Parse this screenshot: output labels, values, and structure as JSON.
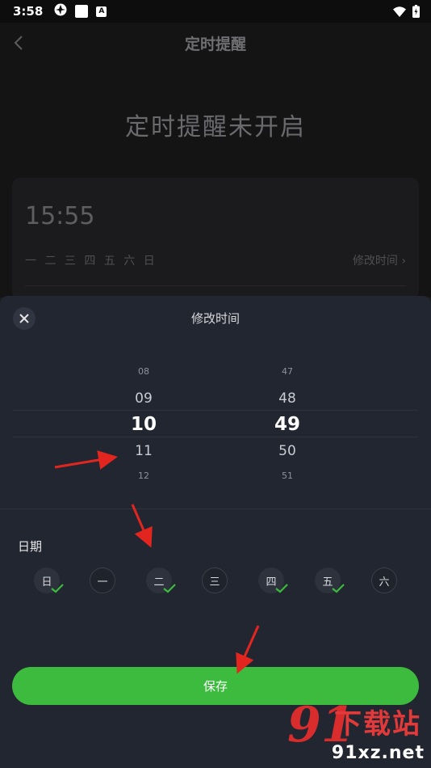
{
  "status_bar": {
    "time": "3:58",
    "icon_a": "A"
  },
  "nav": {
    "title": "定时提醒"
  },
  "reminder": {
    "status_text": "定时提醒未开启",
    "card_time": "15:55",
    "card_days": "一 二 三 四 五 六 日",
    "modify_link": "修改时间 ›"
  },
  "sheet": {
    "title": "修改时间",
    "hours": {
      "far_above": "08",
      "above": "09",
      "selected": "10",
      "below": "11",
      "far_below": "12"
    },
    "minutes": {
      "far_above": "47",
      "above": "48",
      "selected": "49",
      "below": "50",
      "far_below": "51"
    },
    "date_label": "日期",
    "days": [
      {
        "label": "日",
        "checked": true
      },
      {
        "label": "一",
        "checked": false
      },
      {
        "label": "二",
        "checked": true
      },
      {
        "label": "三",
        "checked": false
      },
      {
        "label": "四",
        "checked": true
      },
      {
        "label": "五",
        "checked": true
      },
      {
        "label": "六",
        "checked": false
      }
    ],
    "save_label": "保存"
  },
  "watermark": {
    "number": "91",
    "cn": "下载站",
    "domain": "91xz.net"
  },
  "colors": {
    "accent_green": "#3dbb3e",
    "sheet_bg": "#222630",
    "arrow_red": "#e2261f"
  }
}
